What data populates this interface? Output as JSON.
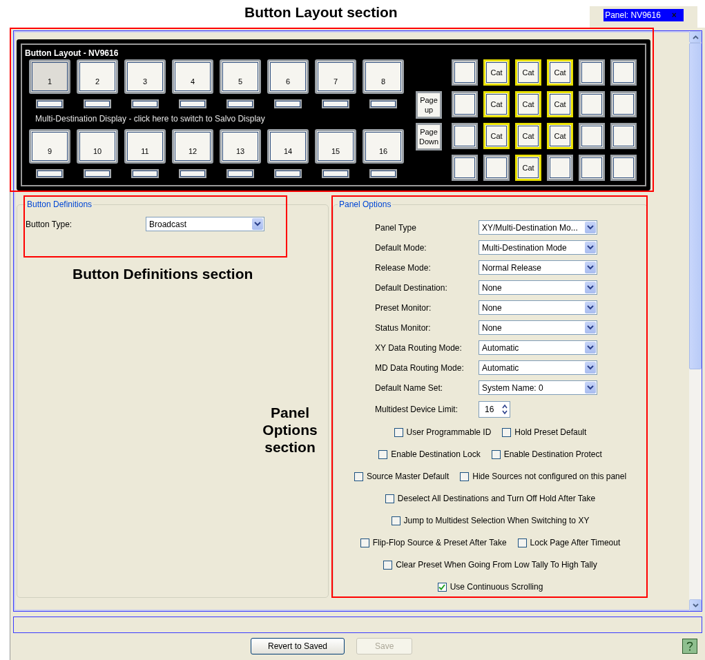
{
  "callouts": {
    "button_layout": "Button Layout section",
    "button_definitions": "Button Definitions section",
    "panel_options": "Panel Options section"
  },
  "tab": {
    "label": "Panel: NV9616",
    "close": "×",
    "selected": true
  },
  "button_layout": {
    "title": "Button Layout - NV9616",
    "row_1": [
      {
        "label": "1",
        "selected": true
      },
      {
        "label": "2",
        "selected": false
      },
      {
        "label": "3",
        "selected": false
      },
      {
        "label": "4",
        "selected": false
      },
      {
        "label": "5",
        "selected": false
      },
      {
        "label": "6",
        "selected": false
      },
      {
        "label": "7",
        "selected": false
      },
      {
        "label": "8",
        "selected": false
      }
    ],
    "mode_link": "Multi-Destination Display - click here to switch to Salvo Display",
    "row_2": [
      {
        "label": "9",
        "selected": false
      },
      {
        "label": "10",
        "selected": false
      },
      {
        "label": "11",
        "selected": false
      },
      {
        "label": "12",
        "selected": false
      },
      {
        "label": "13",
        "selected": false
      },
      {
        "label": "14",
        "selected": false
      },
      {
        "label": "15",
        "selected": false
      },
      {
        "label": "16",
        "selected": false
      }
    ],
    "page_up": "Page up",
    "page_down": "Page Down",
    "grid": [
      [
        {
          "highlighted": false
        },
        {
          "label": "Cat",
          "highlighted": true
        },
        {
          "label": "Cat",
          "highlighted": true
        },
        {
          "label": "Cat",
          "highlighted": true
        },
        {
          "highlighted": false
        },
        {
          "highlighted": false
        }
      ],
      [
        {
          "highlighted": false
        },
        {
          "label": "Cat",
          "highlighted": true
        },
        {
          "label": "Cat",
          "highlighted": true
        },
        {
          "label": "Cat",
          "highlighted": true
        },
        {
          "highlighted": false
        },
        {
          "highlighted": false
        }
      ],
      [
        {
          "highlighted": false
        },
        {
          "label": "Cat",
          "highlighted": true
        },
        {
          "label": "Cat",
          "highlighted": true
        },
        {
          "label": "Cat",
          "highlighted": true
        },
        {
          "highlighted": false
        },
        {
          "highlighted": false
        }
      ],
      [
        {
          "highlighted": false
        },
        {
          "highlighted": false
        },
        {
          "label": "Cat",
          "highlighted": true
        },
        {
          "highlighted": false
        },
        {
          "highlighted": false
        },
        {
          "highlighted": false
        }
      ]
    ]
  },
  "button_definitions": {
    "title": "Button Definitions",
    "fields": [
      {
        "label": "Button Type:",
        "value": "Broadcast"
      }
    ]
  },
  "panel_options": {
    "title": "Panel Options",
    "dropdowns": [
      {
        "label": "Panel Type",
        "value": "XY/Multi-Destination Mo..."
      },
      {
        "label": "Default Mode:",
        "value": "Multi-Destination Mode"
      },
      {
        "label": "Release Mode:",
        "value": "Normal Release"
      },
      {
        "label": "Default Destination:",
        "value": "None"
      },
      {
        "label": "Preset Monitor:",
        "value": "None"
      },
      {
        "label": "Status Monitor:",
        "value": "None"
      },
      {
        "label": "XY Data Routing Mode:",
        "value": "Automatic"
      },
      {
        "label": "MD Data Routing Mode:",
        "value": "Automatic"
      },
      {
        "label": "Default Name Set:",
        "value": "System Name: 0"
      }
    ],
    "spinner": {
      "label": "Multidest Device Limit:",
      "value": "16"
    },
    "checkbox_rows": [
      [
        {
          "label": "User Programmable ID",
          "checked": false
        },
        {
          "label": "Hold Preset Default",
          "checked": false
        }
      ],
      [
        {
          "label": "Enable Destination Lock",
          "checked": false
        },
        {
          "label": "Enable Destination Protect",
          "checked": false
        }
      ],
      [
        {
          "label": "Source Master Default",
          "checked": false
        },
        {
          "label": "Hide Sources not configured on this panel",
          "checked": false
        }
      ],
      [
        {
          "label": "Deselect All Destinations and Turn Off Hold After Take",
          "checked": false
        }
      ],
      [
        {
          "label": "Jump to Multidest Selection When Switching to XY",
          "checked": false
        }
      ],
      [
        {
          "label": "Flip-Flop Source & Preset After Take",
          "checked": false
        },
        {
          "label": "Lock Page After Timeout",
          "checked": false
        }
      ],
      [
        {
          "label": "Clear Preset When Going From Low Tally To High Tally",
          "checked": false
        }
      ],
      [
        {
          "label": "Use Continuous Scrolling",
          "checked": true
        }
      ]
    ]
  },
  "buttons": [
    {
      "label": "Revert to Saved",
      "disabled": false
    },
    {
      "label": "Save",
      "disabled": true
    }
  ]
}
